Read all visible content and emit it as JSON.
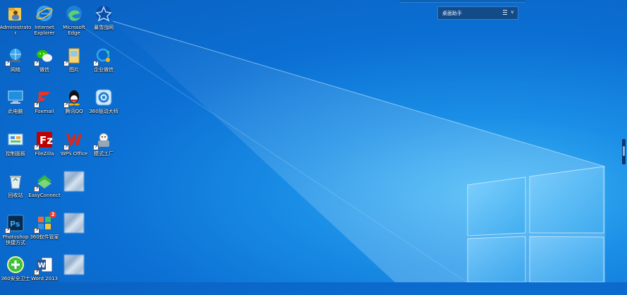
{
  "assistant_widget": {
    "title": "桌面助手",
    "chevron": "∨"
  },
  "desktop_icons": [
    {
      "label": "Administrato\nr",
      "icon": "user-folder-icon"
    },
    {
      "label": "Internet\nExplorer",
      "icon": "internet-explorer-icon"
    },
    {
      "label": "Microsoft\nEdge",
      "icon": "edge-icon"
    },
    {
      "label": "暴雪战网",
      "icon": "battlenet-icon"
    },
    {
      "label": "网络",
      "icon": "network-icon"
    },
    {
      "label": "微信",
      "icon": "wechat-icon"
    },
    {
      "label": "图片",
      "icon": "pictures-folder-icon"
    },
    {
      "label": "企业微信",
      "icon": "wecom-icon"
    },
    {
      "label": "此电脑",
      "icon": "this-pc-icon"
    },
    {
      "label": "Foxmail",
      "icon": "foxmail-icon"
    },
    {
      "label": "腾讯QQ",
      "icon": "qq-icon"
    },
    {
      "label": "360驱动大师",
      "icon": "driver-master-icon"
    },
    {
      "label": "控制面板",
      "icon": "control-panel-icon"
    },
    {
      "label": "FileZilla",
      "icon": "filezilla-icon"
    },
    {
      "label": "WPS Office",
      "icon": "wps-icon"
    },
    {
      "label": "模式工厂",
      "icon": "format-factory-icon"
    },
    {
      "label": "回收站",
      "icon": "recycle-bin-icon"
    },
    {
      "label": "EasyConnect",
      "icon": "easyconnect-icon"
    },
    {
      "label": "",
      "icon": "blurred-icon"
    },
    {
      "label": "Photoshop\n快捷方式",
      "icon": "photoshop-icon"
    },
    {
      "label": "360软件管家",
      "icon": "software-manager-icon"
    },
    {
      "label": "",
      "icon": "blurred-icon"
    },
    {
      "label": "360安全卫士",
      "icon": "360-safe-icon"
    },
    {
      "label": "Word 2013",
      "icon": "word-icon"
    },
    {
      "label": "",
      "icon": "blurred-icon"
    }
  ],
  "badges": {
    "software_manager": "2"
  }
}
